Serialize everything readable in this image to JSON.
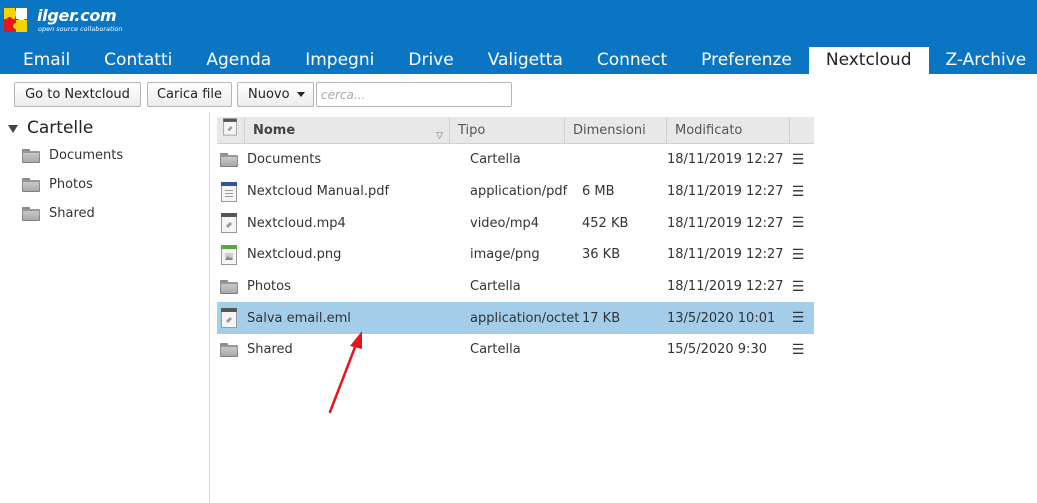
{
  "brand": {
    "name": "ilger.com",
    "tagline": "open source collaboration",
    "colors": {
      "header_bg": "#0a75c2",
      "selected_row": "#a3cde9",
      "arrow": "#e8141b"
    }
  },
  "tabs": [
    {
      "label": "Email"
    },
    {
      "label": "Contatti"
    },
    {
      "label": "Agenda"
    },
    {
      "label": "Impegni"
    },
    {
      "label": "Drive"
    },
    {
      "label": "Valigetta"
    },
    {
      "label": "Connect"
    },
    {
      "label": "Preferenze"
    },
    {
      "label": "Nextcloud",
      "active": true
    },
    {
      "label": "Z-Archive"
    }
  ],
  "toolbar": {
    "goto_label": "Go to Nextcloud",
    "upload_label": "Carica file",
    "new_label": "Nuovo",
    "search_placeholder": "cerca..."
  },
  "sidebar": {
    "title": "Cartelle",
    "items": [
      {
        "label": "Documents"
      },
      {
        "label": "Photos"
      },
      {
        "label": "Shared"
      }
    ]
  },
  "grid": {
    "columns": {
      "name": "Nome",
      "type": "Tipo",
      "size": "Dimensioni",
      "modified": "Modificato"
    },
    "rows": [
      {
        "icon": "folder-icon",
        "name": "Documents",
        "type": "Cartella",
        "size": "",
        "modified": "18/11/2019 12:27",
        "menu": "☰"
      },
      {
        "icon": "pdf-file-icon",
        "name": "Nextcloud Manual.pdf",
        "type": "application/pdf",
        "size": "6 MB",
        "modified": "18/11/2019 12:27",
        "menu": "☰"
      },
      {
        "icon": "generic-file-icon",
        "name": "Nextcloud.mp4",
        "type": "video/mp4",
        "size": "452 KB",
        "modified": "18/11/2019 12:27",
        "menu": "☰"
      },
      {
        "icon": "image-file-icon",
        "name": "Nextcloud.png",
        "type": "image/png",
        "size": "36 KB",
        "modified": "18/11/2019 12:27",
        "menu": "☰"
      },
      {
        "icon": "folder-icon",
        "name": "Photos",
        "type": "Cartella",
        "size": "",
        "modified": "18/11/2019 12:27",
        "menu": "☰"
      },
      {
        "icon": "generic-file-icon",
        "name": "Salva email.eml",
        "type": "application/octet",
        "size": "17 KB",
        "modified": "13/5/2020 10:01",
        "menu": "☰",
        "selected": true
      },
      {
        "icon": "folder-icon",
        "name": "Shared",
        "type": "Cartella",
        "size": "",
        "modified": "15/5/2020 9:30",
        "menu": "☰"
      }
    ]
  }
}
